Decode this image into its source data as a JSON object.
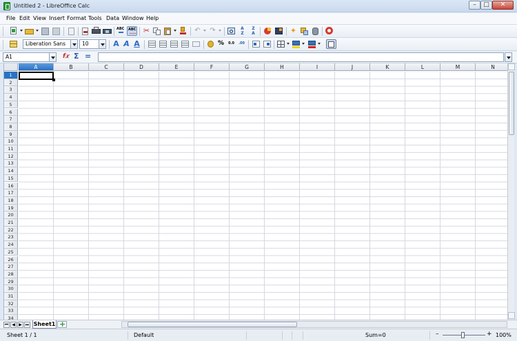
{
  "window": {
    "title": "Untitled 2 - LibreOffice Calc",
    "controls": {
      "minimize": "–",
      "maximize": "□",
      "close": "✕"
    }
  },
  "menu": [
    "File",
    "Edit",
    "View",
    "Insert",
    "Format",
    "Tools",
    "Data",
    "Window",
    "Help"
  ],
  "toolbar_format": {
    "font_name": "Liberation Sans",
    "font_size": "10"
  },
  "formula_bar": {
    "name_box": "A1",
    "content": ""
  },
  "grid": {
    "columns": [
      "A",
      "B",
      "C",
      "D",
      "E",
      "F",
      "G",
      "H",
      "I",
      "J",
      "K",
      "L",
      "M",
      "N"
    ],
    "rows": [
      "1",
      "2",
      "3",
      "4",
      "5",
      "6",
      "7",
      "8",
      "9",
      "10",
      "11",
      "12",
      "13",
      "14",
      "15",
      "16",
      "17",
      "18",
      "19",
      "20",
      "21",
      "22",
      "23",
      "24",
      "25",
      "26",
      "27",
      "28",
      "29",
      "30",
      "31",
      "32",
      "33",
      "34"
    ],
    "active_column": "A",
    "active_row": "1"
  },
  "tabs": {
    "sheets": [
      "Sheet1"
    ],
    "active": "Sheet1"
  },
  "status": {
    "sheet": "Sheet 1 / 1",
    "page_style": "Default",
    "sum": "Sum=0",
    "zoom": "100%",
    "zoom_minus": "–",
    "zoom_plus": "+"
  },
  "colors": {
    "accent": "#2a72c4",
    "header_bg": "#e5e9ef",
    "gridline": "#d3d8df"
  }
}
